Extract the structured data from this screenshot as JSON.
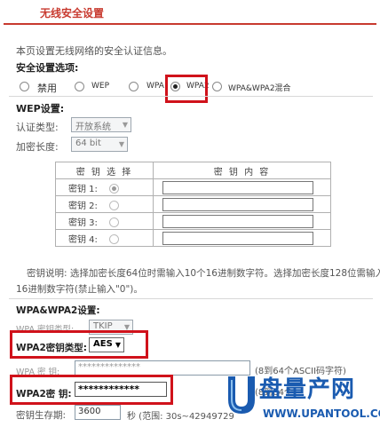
{
  "header": {
    "title": "无线安全设置"
  },
  "intro": "本页设置无线网络的安全认证信息。",
  "security_options": {
    "label": "安全设置选项:",
    "options": [
      "禁用",
      "WEP",
      "WPA",
      "WPA2",
      "WPA&WPA2混合"
    ],
    "selected": "WPA2"
  },
  "wep": {
    "section_title": "WEP设置:",
    "auth_label": "认证类型:",
    "auth_value": "开放系统",
    "keylen_label": "加密长度:",
    "keylen_value": "64 bit",
    "table_headers": [
      "密 钥 选 择",
      "密 钥 内 容"
    ],
    "keys": [
      {
        "label": "密钥 1:",
        "selected": true
      },
      {
        "label": "密钥 2:",
        "selected": false
      },
      {
        "label": "密钥 3:",
        "selected": false
      },
      {
        "label": "密钥 4:",
        "selected": false
      }
    ],
    "note_line1": "密钥说明: 选择加密长度64位时需输入10个16进制数字符。选择加密长度128位需输入",
    "note_line2": "16进制数字符(禁止输入\"0\")。"
  },
  "wpa": {
    "section_title": "WPA&WPA2设置:",
    "wpa_cipher_label": "WPA 密钥类型:",
    "wpa_cipher_value": "TKIP",
    "wpa2_cipher_label": "WPA2密钥类型:",
    "wpa2_cipher_value": "AES",
    "wpa_key_label": "WPA 密  钥:",
    "wpa_key_value": "**************",
    "wpa_key_hint": "(8到64个ASCII码字符)",
    "wpa2_key_label": "WPA2密  钥:",
    "wpa2_key_value": "************",
    "wpa2_key_hint": "(8到64个",
    "lifetime_label": "密钥生存期:",
    "lifetime_value": "3600",
    "lifetime_hint": "秒 (范围: 30s~42949729"
  },
  "watermark": {
    "brand_cn": "盘量产网",
    "brand_en": "WWW.UPANTOOL.COM"
  },
  "colors": {
    "accent": "#c83a2f",
    "highlight": "#d0121b",
    "brand": "#1a5bb0"
  }
}
